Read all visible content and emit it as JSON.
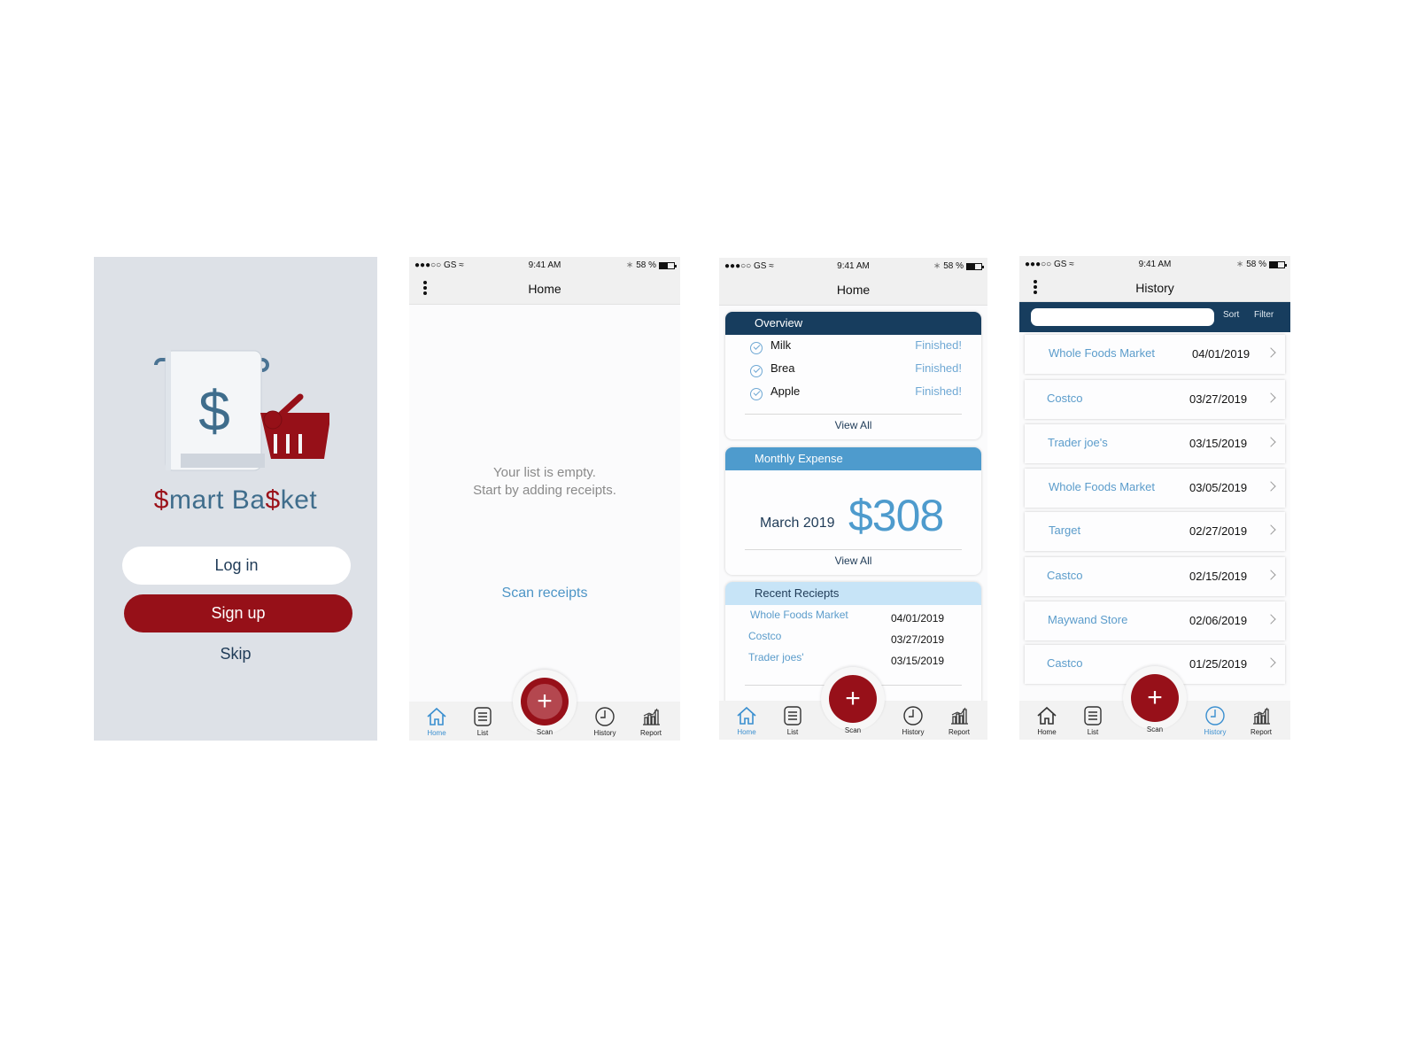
{
  "splash": {
    "brand_parts": [
      "$",
      "mart Ba",
      "$",
      "ket"
    ],
    "login_label": "Log in",
    "signup_label": "Sign up",
    "skip_label": "Skip",
    "colors": {
      "background": "#dde1e7",
      "accent_red": "#961018",
      "navy": "#1f3b57",
      "steel_blue": "#3f6d8c"
    }
  },
  "status_bar": {
    "carrier": "●●●○○ GS",
    "time": "9:41 AM",
    "battery": "58 %"
  },
  "tabs": [
    {
      "label": "Home",
      "icon": "home-icon"
    },
    {
      "label": "List",
      "icon": "list-icon"
    },
    {
      "label": "Scan",
      "icon": "plus-icon"
    },
    {
      "label": "History",
      "icon": "clock-icon"
    },
    {
      "label": "Report",
      "icon": "bar-chart-icon"
    }
  ],
  "empty_home": {
    "title": "Home",
    "empty_line1": "Your list is empty.",
    "empty_line2": "Start by adding receipts.",
    "scan_link": "Scan receipts",
    "active_tab": "Home"
  },
  "dashboard": {
    "title": "Home",
    "overview": {
      "heading": "Overview",
      "items": [
        {
          "name": "Milk",
          "status": "Finished!"
        },
        {
          "name": "Brea",
          "status": "Finished!"
        },
        {
          "name": "Apple",
          "status": "Finished!"
        }
      ],
      "view_all": "View All"
    },
    "monthly_expense": {
      "heading": "Monthly Expense",
      "month": "March 2019",
      "amount": "$308",
      "view_all": "View All"
    },
    "recent_receipts": {
      "heading": "Recent Reciepts",
      "items": [
        {
          "store": "Whole Foods Market",
          "date": "04/01/2019"
        },
        {
          "store": "Costco",
          "date": "03/27/2019"
        },
        {
          "store": "Trader joes'",
          "date": "03/15/2019"
        }
      ]
    },
    "active_tab": "Home"
  },
  "history": {
    "title": "History",
    "search_placeholder": "",
    "sort_label": "Sort",
    "filter_label": "Filter",
    "rows": [
      {
        "store": "Whole Foods Market",
        "date": "04/01/2019"
      },
      {
        "store": "Costco",
        "date": "03/27/2019"
      },
      {
        "store": "Trader joe's",
        "date": "03/15/2019"
      },
      {
        "store": "Whole Foods Market",
        "date": "03/05/2019"
      },
      {
        "store": "Target",
        "date": "02/27/2019"
      },
      {
        "store": "Castco",
        "date": "02/15/2019"
      },
      {
        "store": "Maywand Store",
        "date": "02/06/2019"
      },
      {
        "store": "Castco",
        "date": "01/25/2019"
      }
    ],
    "active_tab": "History"
  },
  "fab_symbol": "+"
}
